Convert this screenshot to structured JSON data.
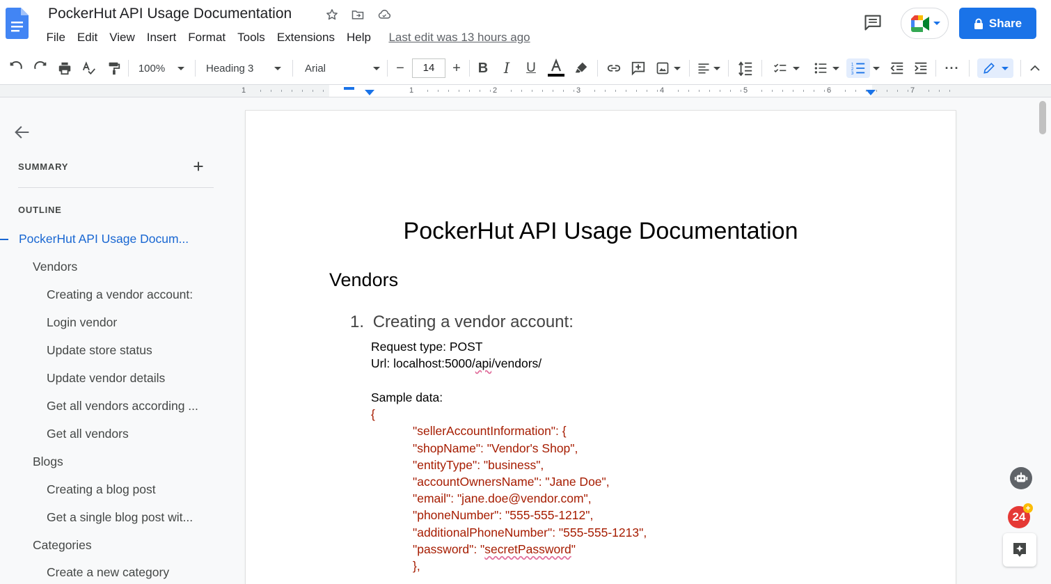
{
  "app": {
    "doc_title": "PockerHut API Usage Documentation",
    "menu": [
      "File",
      "Edit",
      "View",
      "Insert",
      "Format",
      "Tools",
      "Extensions",
      "Help"
    ],
    "last_edit": "Last edit was 13 hours ago",
    "share_label": "Share"
  },
  "toolbar": {
    "zoom": "100%",
    "style": "Heading 3",
    "font": "Arial",
    "font_size": "14",
    "minus": "−",
    "plus": "+"
  },
  "ruler": {
    "numbers": [
      "1",
      "1",
      "2",
      "3",
      "4",
      "5",
      "6",
      "7"
    ]
  },
  "sidebar": {
    "summary_label": "SUMMARY",
    "outline_label": "OUTLINE",
    "outline": [
      {
        "label": "PockerHut API Usage Docum...",
        "level": 0
      },
      {
        "label": "Vendors",
        "level": 1
      },
      {
        "label": "Creating a vendor account:",
        "level": 2
      },
      {
        "label": "Login vendor",
        "level": 2
      },
      {
        "label": "Update store status",
        "level": 2
      },
      {
        "label": "Update vendor details",
        "level": 2
      },
      {
        "label": "Get all vendors according ...",
        "level": 2
      },
      {
        "label": "Get all vendors",
        "level": 2
      },
      {
        "label": "Blogs",
        "level": 1
      },
      {
        "label": "Creating a blog post",
        "level": 2
      },
      {
        "label": "Get a single blog post wit...",
        "level": 2
      },
      {
        "label": "Categories",
        "level": 1
      },
      {
        "label": "Create a new category",
        "level": 2
      }
    ]
  },
  "document": {
    "title": "PockerHut API Usage Documentation",
    "section": "Vendors",
    "item_number": "1.",
    "item_heading": "Creating a vendor account:",
    "request_type": "Request type: POST",
    "url_prefix": "Url: localhost:5000/",
    "url_api": "api",
    "url_suffix": "/vendors/",
    "sample_label": "Sample data:",
    "open_brace": "{",
    "code_lines": [
      "\"sellerAccountInformation\": {",
      "\"shopName\": \"Vendor's Shop\",",
      "\"entityType\": \"business\",",
      "\"accountOwnersName\": \"Jane Doe\",",
      "\"email\": \"jane.doe@vendor.com\",",
      "\"phoneNumber\": \"555-555-1212\",",
      "\"additionalPhoneNumber\": \"555-555-1213\","
    ],
    "password_key": "\"password\": \"",
    "password_value": "secretPassword",
    "password_end": "\"",
    "close_partial": "},"
  },
  "badge": {
    "count": "24"
  },
  "colors": {
    "accent": "#1a73e8",
    "code": "#a61c00",
    "outline_active": "#1967d2"
  }
}
